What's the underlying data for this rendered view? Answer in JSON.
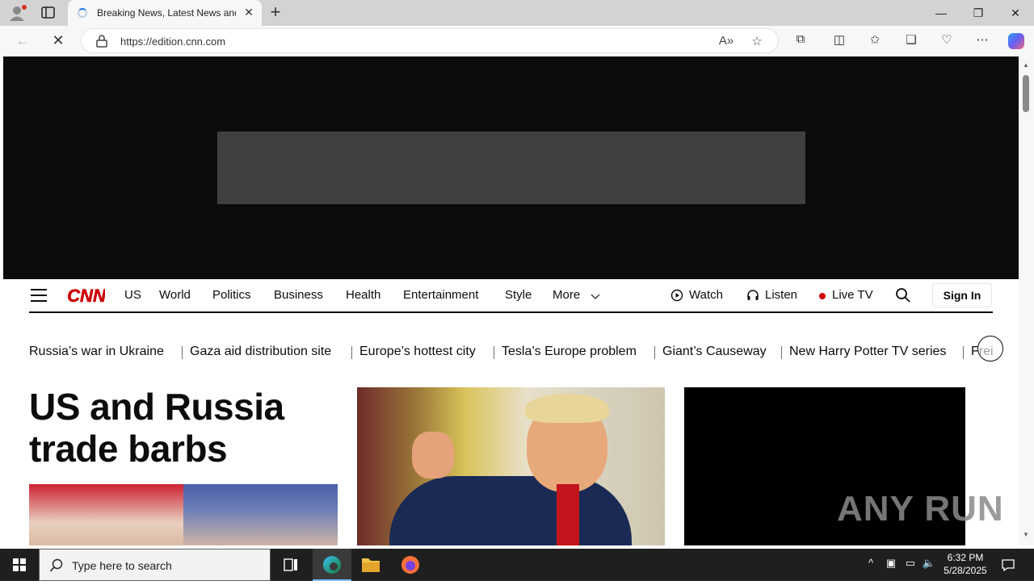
{
  "browser": {
    "tab_title": "Breaking News, Latest News and",
    "url": "https://edition.cnn.com",
    "new_tab_label": "+",
    "tab_close_label": "✕"
  },
  "site": {
    "logo_text": "CNN",
    "brand_color": "#cc0000",
    "nav_links": [
      "US",
      "World",
      "Politics",
      "Business",
      "Health",
      "Entertainment",
      "Style",
      "More"
    ],
    "watch_label": "Watch",
    "listen_label": "Listen",
    "live_tv_label": "Live TV",
    "sign_in_label": "Sign In",
    "trending": [
      "Russia’s war in Ukraine",
      "Gaza aid distribution site",
      "Europe’s hottest city",
      "Tesla’s Europe problem",
      "Giant’s Causeway",
      "New Harry Potter TV series",
      "Frei"
    ],
    "headline": "US and Russia trade barbs",
    "watermark": "ANY RUN"
  },
  "taskbar": {
    "search_placeholder": "Type here to search",
    "time": "6:32 PM",
    "date": "5/28/2025"
  }
}
